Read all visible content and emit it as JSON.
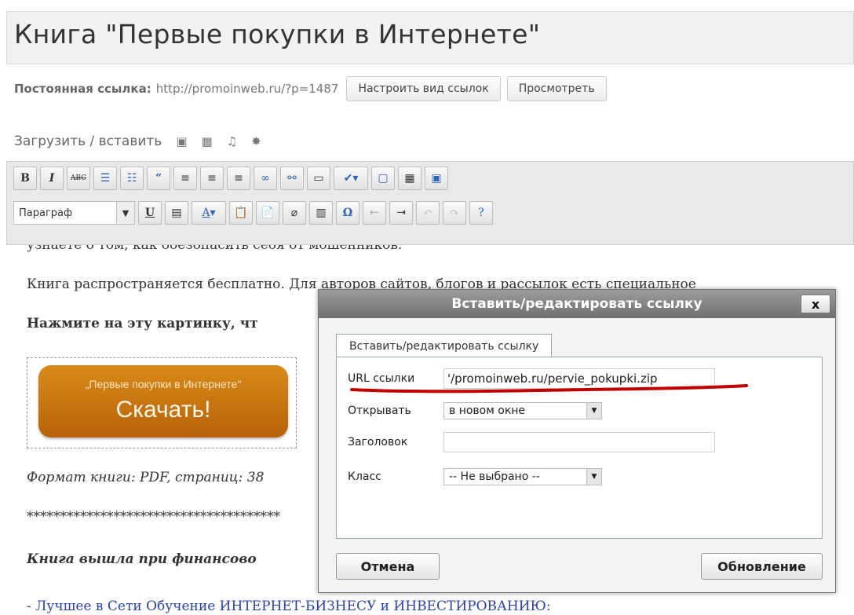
{
  "post": {
    "title": "Книга \"Первые покупки в Интернете\"",
    "permalink_label": "Постоянная ссылка:",
    "permalink_url": "http://promoinweb.ru/?p=1487",
    "btn_customize": "Настроить вид ссылок",
    "btn_view": "Просмотреть"
  },
  "media": {
    "label": "Загрузить / вставить"
  },
  "toolbar": {
    "format_value": "Параграф"
  },
  "content": {
    "line_top": "узнаете о том, как обезопасить себя от мошенников.",
    "line1": "Книга распространяется бесплатно. Для авторов сайтов, блогов и рассылок есть специальное",
    "line2": "Нажмите на эту картинку, чт",
    "download_sub": "„Первые покупки в Интернете\"",
    "download_main": "Скачать!",
    "format_line": "Формат книги: PDF, страниц: 38",
    "stars": "**************************************",
    "bold_italic": "Книга вышла при финансово",
    "bottom_link": "- Лучшее в Сети Обучение ИНТЕРНЕТ-БИЗНЕСУ и ИНВЕСТИРОВАНИЮ:"
  },
  "dialog": {
    "title": "Вставить/редактировать ссылку",
    "close": "x",
    "tab": "Вставить/редактировать ссылку",
    "url_label": "URL ссылки",
    "url_value": "'/promoinweb.ru/pervie_pokupki.zip",
    "target_label": "Открывать",
    "target_value": "в новом окне",
    "title_label": "Заголовок",
    "title_value": "",
    "class_label": "Класс",
    "class_value": "-- Не выбрано --",
    "cancel": "Отмена",
    "update": "Обновление",
    "underline_color": "#c00000"
  }
}
